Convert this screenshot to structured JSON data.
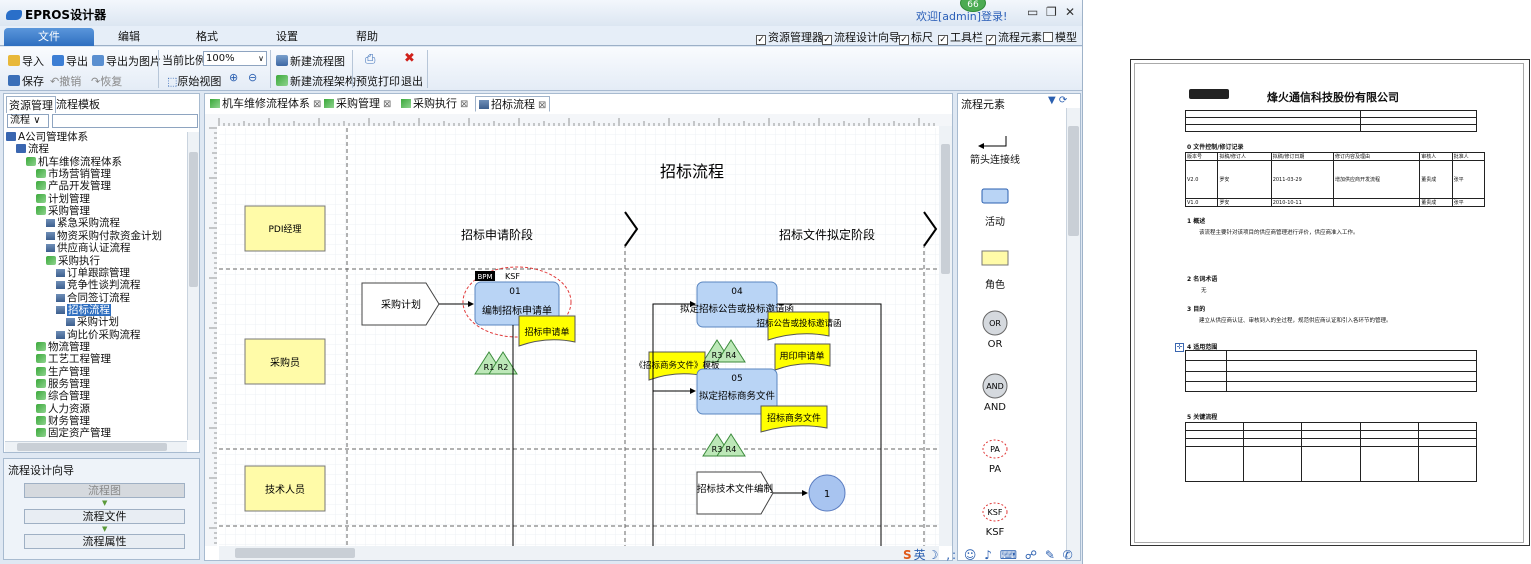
{
  "app": {
    "title": "EPROS设计器",
    "welcome": "欢迎[admin]登录!",
    "badge": "66"
  },
  "menu": {
    "tabs": [
      "文件",
      "编辑",
      "格式",
      "设置",
      "帮助"
    ],
    "active": 0
  },
  "view_toggles": [
    {
      "label": "资源管理器",
      "checked": true
    },
    {
      "label": "流程设计向导",
      "checked": true
    },
    {
      "label": "标尺",
      "checked": true
    },
    {
      "label": "工具栏",
      "checked": true
    },
    {
      "label": "流程元素",
      "checked": true
    },
    {
      "label": "模型",
      "checked": false
    }
  ],
  "ribbon": {
    "import": "导入",
    "export": "导出",
    "export_image": "导出为图片",
    "save": "保存",
    "undo": "撤销",
    "redo": "恢复",
    "zoom_label": "当前比例",
    "zoom_value": "100%",
    "original_view": "原始视图",
    "new_flow_map": "新建流程图",
    "new_flow_arch": "新建流程架构",
    "print_preview": "预览打印",
    "exit": "退出"
  },
  "left_panel": {
    "tabs": [
      "资源管理",
      "流程模板"
    ],
    "filter_value": "流程",
    "tree": [
      {
        "label": "A公司管理体系",
        "depth": 0,
        "icon": "root"
      },
      {
        "label": "流程",
        "depth": 1,
        "icon": "root"
      },
      {
        "label": "机车维修流程体系",
        "depth": 2,
        "icon": "fold"
      },
      {
        "label": "市场营销管理",
        "depth": 3,
        "icon": "fold"
      },
      {
        "label": "产品开发管理",
        "depth": 3,
        "icon": "fold"
      },
      {
        "label": "计划管理",
        "depth": 3,
        "icon": "fold"
      },
      {
        "label": "采购管理",
        "depth": 3,
        "icon": "fold"
      },
      {
        "label": "紧急采购流程",
        "depth": 4,
        "icon": "flow"
      },
      {
        "label": "物资采购付款资金计划",
        "depth": 4,
        "icon": "flow"
      },
      {
        "label": "供应商认证流程",
        "depth": 4,
        "icon": "flow"
      },
      {
        "label": "采购执行",
        "depth": 4,
        "icon": "fold"
      },
      {
        "label": "订单跟踪管理",
        "depth": 5,
        "icon": "flow"
      },
      {
        "label": "竞争性谈判流程",
        "depth": 5,
        "icon": "flow"
      },
      {
        "label": "合同签订流程",
        "depth": 5,
        "icon": "flow"
      },
      {
        "label": "招标流程",
        "depth": 5,
        "icon": "flow",
        "selected": true
      },
      {
        "label": "采购计划",
        "depth": 6,
        "icon": "flow"
      },
      {
        "label": "询比价采购流程",
        "depth": 5,
        "icon": "flow"
      },
      {
        "label": "物流管理",
        "depth": 3,
        "icon": "fold"
      },
      {
        "label": "工艺工程管理",
        "depth": 3,
        "icon": "fold"
      },
      {
        "label": "生产管理",
        "depth": 3,
        "icon": "fold"
      },
      {
        "label": "服务管理",
        "depth": 3,
        "icon": "fold"
      },
      {
        "label": "综合管理",
        "depth": 3,
        "icon": "fold"
      },
      {
        "label": "人力资源",
        "depth": 3,
        "icon": "fold"
      },
      {
        "label": "财务管理",
        "depth": 3,
        "icon": "fold"
      },
      {
        "label": "固定资产管理",
        "depth": 3,
        "icon": "fold"
      }
    ]
  },
  "guide": {
    "title": "流程设计向导",
    "buttons": [
      "流程图",
      "流程文件",
      "流程属性"
    ]
  },
  "editor_tabs": [
    {
      "label": "机车维修流程体系"
    },
    {
      "label": "采购管理"
    },
    {
      "label": "采购执行"
    },
    {
      "label": "招标流程",
      "active": true
    }
  ],
  "diagram": {
    "title": "招标流程",
    "phases": [
      "招标申请阶段",
      "招标文件拟定阶段"
    ],
    "roles": [
      "PDI经理",
      "采购员",
      "技术人员"
    ],
    "nodes": {
      "plan": "采购计划",
      "a01_num": "01",
      "a01": "编制招标申请单",
      "a01_doc": "招标申请单",
      "a04_num": "04",
      "a04": "拟定招标公告或投标邀请函",
      "a04_doc": "招标公告或投标邀请函",
      "print_doc": "用印申请单",
      "template_doc": "《招标商务文件》模板",
      "a05_num": "05",
      "a05": "拟定招标商务文件",
      "a05_doc": "招标商务文件",
      "tech": "招标技术文件编制",
      "circle": "1",
      "bpm": "BPM",
      "ksf": "KSF",
      "r1": "R1",
      "r2": "R2",
      "r3": "R3",
      "r4": "R4"
    }
  },
  "elements_panel": {
    "title": "流程元素",
    "items": [
      {
        "label": "箭头连接线",
        "icon": "arrow-connector-icon"
      },
      {
        "label": "活动",
        "icon": "activity-icon"
      },
      {
        "label": "角色",
        "icon": "role-icon"
      },
      {
        "label": "OR",
        "sub": "OR",
        "icon": "or-gateway-icon"
      },
      {
        "label": "AND",
        "sub": "AND",
        "icon": "and-gateway-icon"
      },
      {
        "label": "PA",
        "sub": "PA",
        "icon": "pa-icon"
      },
      {
        "label": "KSF",
        "sub": "KSF",
        "icon": "ksf-icon"
      }
    ]
  },
  "status_icons": "英",
  "doc": {
    "company": "烽火通信科技股份有限公司",
    "sections": [
      "0 文件控制/修订记录",
      "1 概述",
      "2 名词术语",
      "3 目的",
      "4 适用范围",
      "5 关键流程"
    ],
    "term_value": "无",
    "overview": "该流程主要针对该项目的供应商管理进行评价，供应商准入工作。",
    "purpose": "建立从供应商认证、审核到入的全过程，规范供应商认证和引入各环节的管理。",
    "rev_headers": [
      "版本号",
      "拟稿/修订人",
      "拟稿/修订日期",
      "修订内容及理由",
      "审核人",
      "批准人"
    ],
    "rev_rows": [
      [
        "V2.0",
        "罗安",
        "2011-03-29",
        "增加供应商开发流程",
        "董贵成",
        "张平"
      ],
      [
        "V1.0",
        "罗安",
        "2010-10-11",
        "",
        "董贵成",
        "张平"
      ]
    ]
  }
}
